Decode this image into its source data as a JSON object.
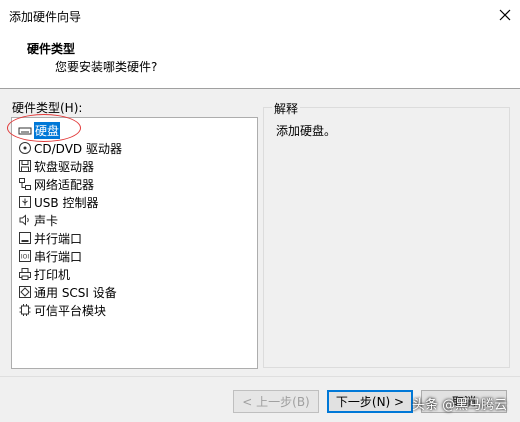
{
  "window": {
    "title": "添加硬件向导"
  },
  "header": {
    "title": "硬件类型",
    "subtitle": "您要安装哪类硬件?"
  },
  "list": {
    "label": "硬件类型(H):",
    "items": [
      {
        "label": "硬盘",
        "icon": "hard-disk-icon",
        "selected": true
      },
      {
        "label": "CD/DVD 驱动器",
        "icon": "cd-dvd-icon"
      },
      {
        "label": "软盘驱动器",
        "icon": "floppy-icon"
      },
      {
        "label": "网络适配器",
        "icon": "network-adapter-icon"
      },
      {
        "label": "USB 控制器",
        "icon": "usb-icon"
      },
      {
        "label": "声卡",
        "icon": "sound-card-icon"
      },
      {
        "label": "并行端口",
        "icon": "parallel-port-icon"
      },
      {
        "label": "串行端口",
        "icon": "serial-port-icon"
      },
      {
        "label": "打印机",
        "icon": "printer-icon"
      },
      {
        "label": "通用 SCSI 设备",
        "icon": "scsi-icon"
      },
      {
        "label": "可信平台模块",
        "icon": "tpm-icon"
      }
    ]
  },
  "explanation": {
    "label": "解释",
    "text": "添加硬盘。"
  },
  "buttons": {
    "back": "< 上一步(B)",
    "next": "下一步(N) >",
    "cancel": "取消"
  },
  "watermark": "头条 @黑马腾云",
  "colors": {
    "selection": "#0078d7",
    "annotation": "#e23b3b"
  }
}
